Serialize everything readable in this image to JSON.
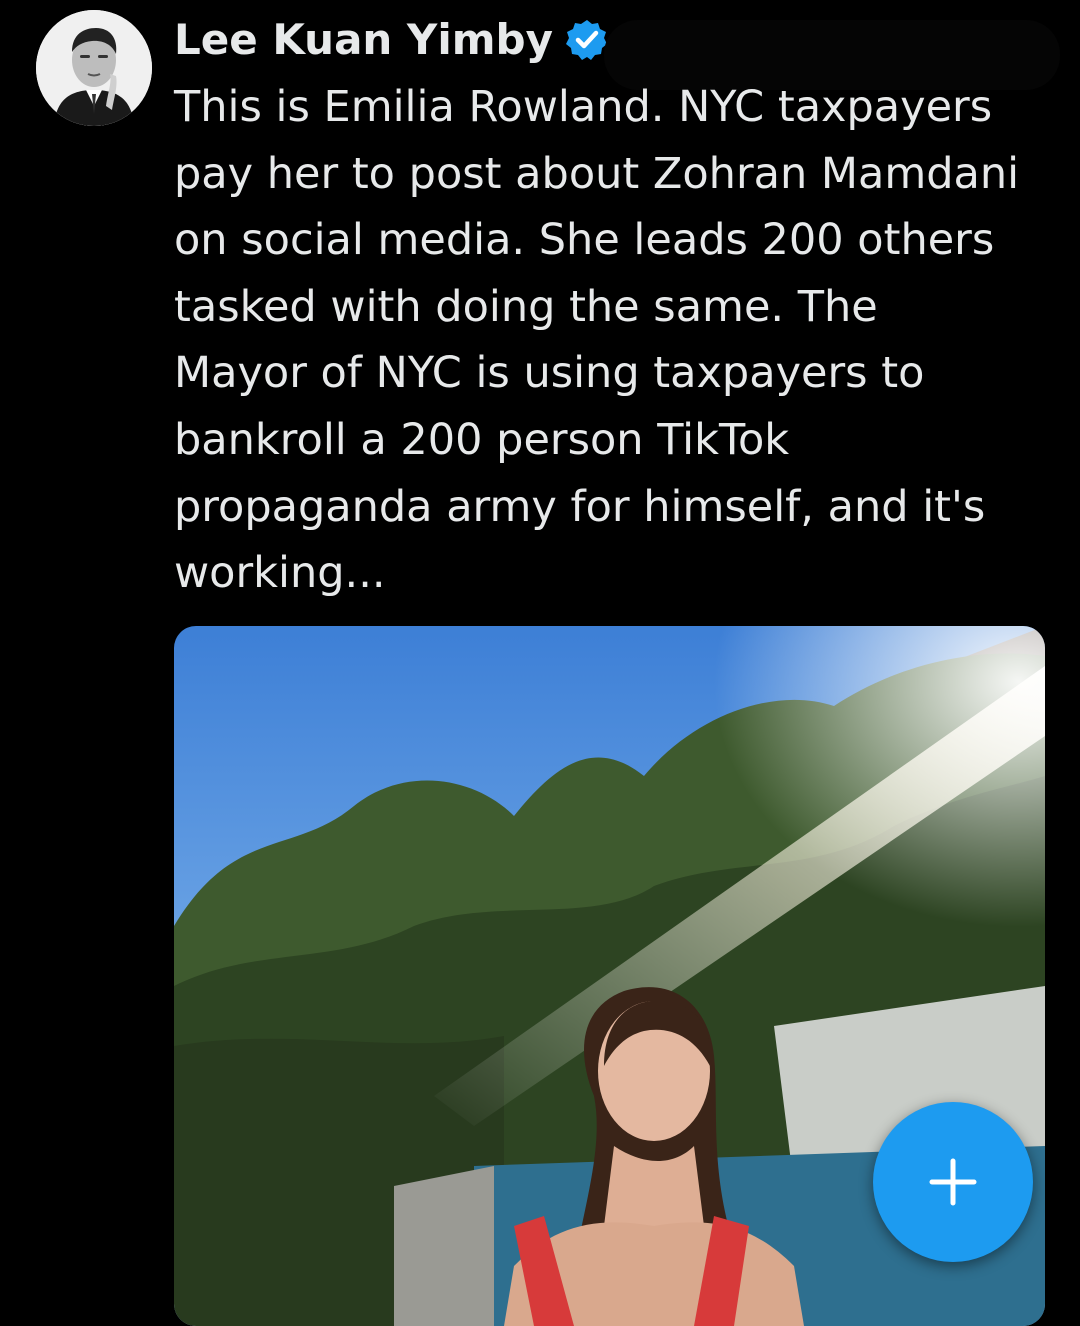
{
  "author": {
    "display_name": "Lee Kuan Yimby",
    "verified_badge_color": "#1d9bf0",
    "avatar_icon": "profile-photo-avatar"
  },
  "tweet": {
    "text": "This is Emilia Rowland. NYC taxpayers\npay her to post about Zohran Mamdani\non social media. She leads 200 others\ntasked with doing the same. The\nMayor of NYC is using taxpayers to\nbankroll a 200 person TikTok\npropaganda army for himself, and it's\nworking..."
  },
  "media": {
    "kind": "photo"
  },
  "compose_button": {
    "icon": "plus-icon",
    "color": "#1d9bf0"
  },
  "colors": {
    "background": "#000000",
    "text": "#e7e9ea",
    "accent": "#1d9bf0"
  }
}
